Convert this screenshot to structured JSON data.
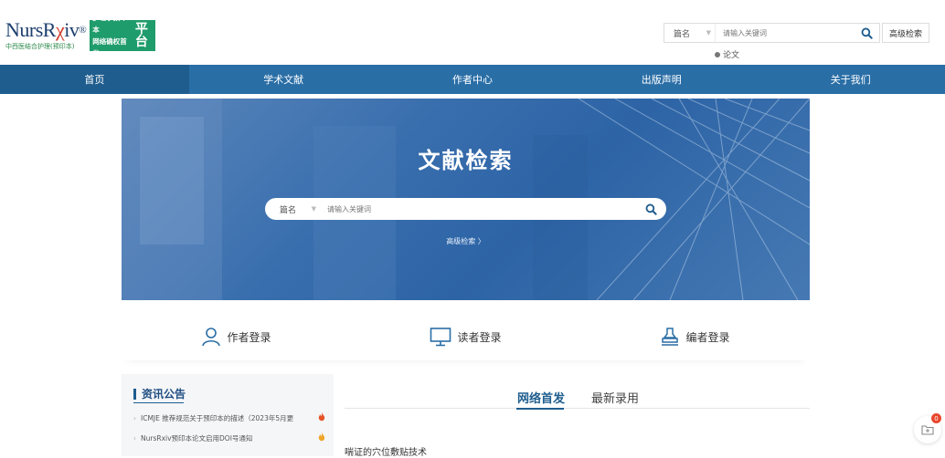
{
  "logo": {
    "name_prefix": "NursR",
    "name_mid": "χ",
    "name_suffix": "iv",
    "registered": "®",
    "subtitle": "中西医结合护理(预印本)",
    "badge_line1": "护理学预印本",
    "badge_line2": "网络确权首发",
    "badge_big": "平台"
  },
  "top_search": {
    "field": "篇名",
    "placeholder": "请输入关键词",
    "advanced": "高级检索",
    "radio_label": "论文"
  },
  "nav": [
    {
      "label": "首页",
      "active": true
    },
    {
      "label": "学术文献",
      "active": false
    },
    {
      "label": "作者中心",
      "active": false
    },
    {
      "label": "出版声明",
      "active": false
    },
    {
      "label": "关于我们",
      "active": false
    }
  ],
  "banner": {
    "title": "文献检索",
    "field": "篇名",
    "placeholder": "请输入关键词",
    "advanced": "高级检索 〉"
  },
  "login": {
    "author": "作者登录",
    "reader": "读者登录",
    "editor": "编者登录"
  },
  "news": {
    "title": "资讯公告",
    "items": [
      {
        "text": "ICMJE 推荐规范关于预印本的描述（2023年5月更"
      },
      {
        "text": "NursRxiv预印本论文启用DOI号通知"
      }
    ]
  },
  "tabs": {
    "first": "网络首发",
    "second": "最新录用"
  },
  "articles": [
    "喘证的穴位敷贴技术"
  ],
  "float": {
    "badge": "0"
  },
  "colors": {
    "nav": "#2a6ea6",
    "accent": "#1f5d8e",
    "logo_green": "#1f9c6b"
  }
}
